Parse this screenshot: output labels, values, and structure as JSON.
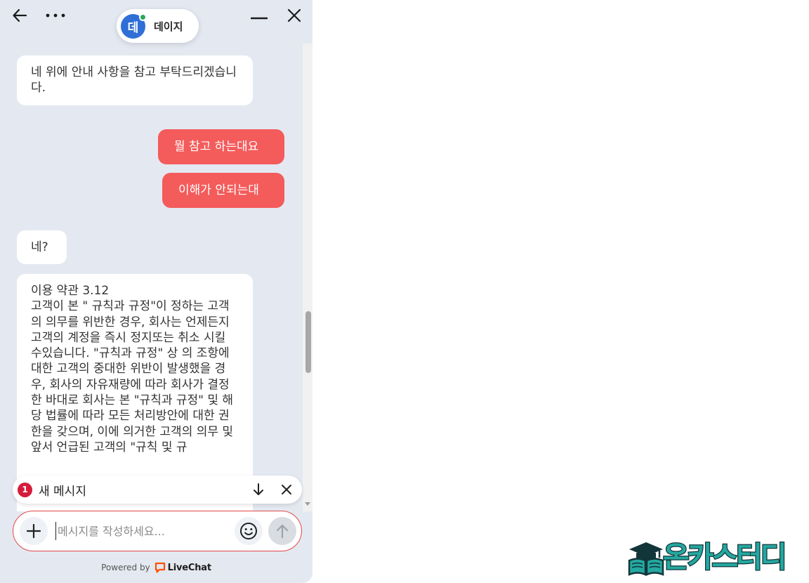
{
  "agent": {
    "name": "데이지",
    "avatar_letter": "데"
  },
  "messages": [
    {
      "from": "agent",
      "text": "네 위에 안내 사항을 참고 부탁드리겠습니다."
    },
    {
      "from": "user",
      "text": "뭘 참고 하는대요"
    },
    {
      "from": "user",
      "text": "이해가 안되는대"
    },
    {
      "from": "agent",
      "text": "네?"
    },
    {
      "from": "agent",
      "text": "이용 약관 3.12\n고객이 본 \" 규칙과 규정\"이 정하는 고객의 의무를 위반한 경우, 회사는 언제든지 고객의 계정을 즉시 정지또는 취소 시킬 수있습니다. \"규칙과 규정\" 상 의 조항에 대한 고객의 중대한 위반이 발생했을 경우, 회사의 자유재량에 따라 회사가 결정한 바대로 회사는 본 \"규칙과 규정\" 및 해당 법률에 따라 모든 처리방안에 대한 권한을 갖으며, 이에 의거한 고객의 의무 및 앞서 언급된 고객의 \"규칙 및 규"
    }
  ],
  "new_message_bar": {
    "count": "1",
    "label": "새 메시지"
  },
  "composer": {
    "placeholder": "메시지를 작성하세요..."
  },
  "footer": {
    "powered_by": "Powered by",
    "brand": "LiveChat"
  },
  "watermark": {
    "text": "온카스터디"
  },
  "colors": {
    "user_bubble": "#f45b5b",
    "badge": "#d61b3a",
    "composer_border": "#e24848",
    "agent_avatar": "#2f6fd6",
    "online": "#2aa75c"
  }
}
